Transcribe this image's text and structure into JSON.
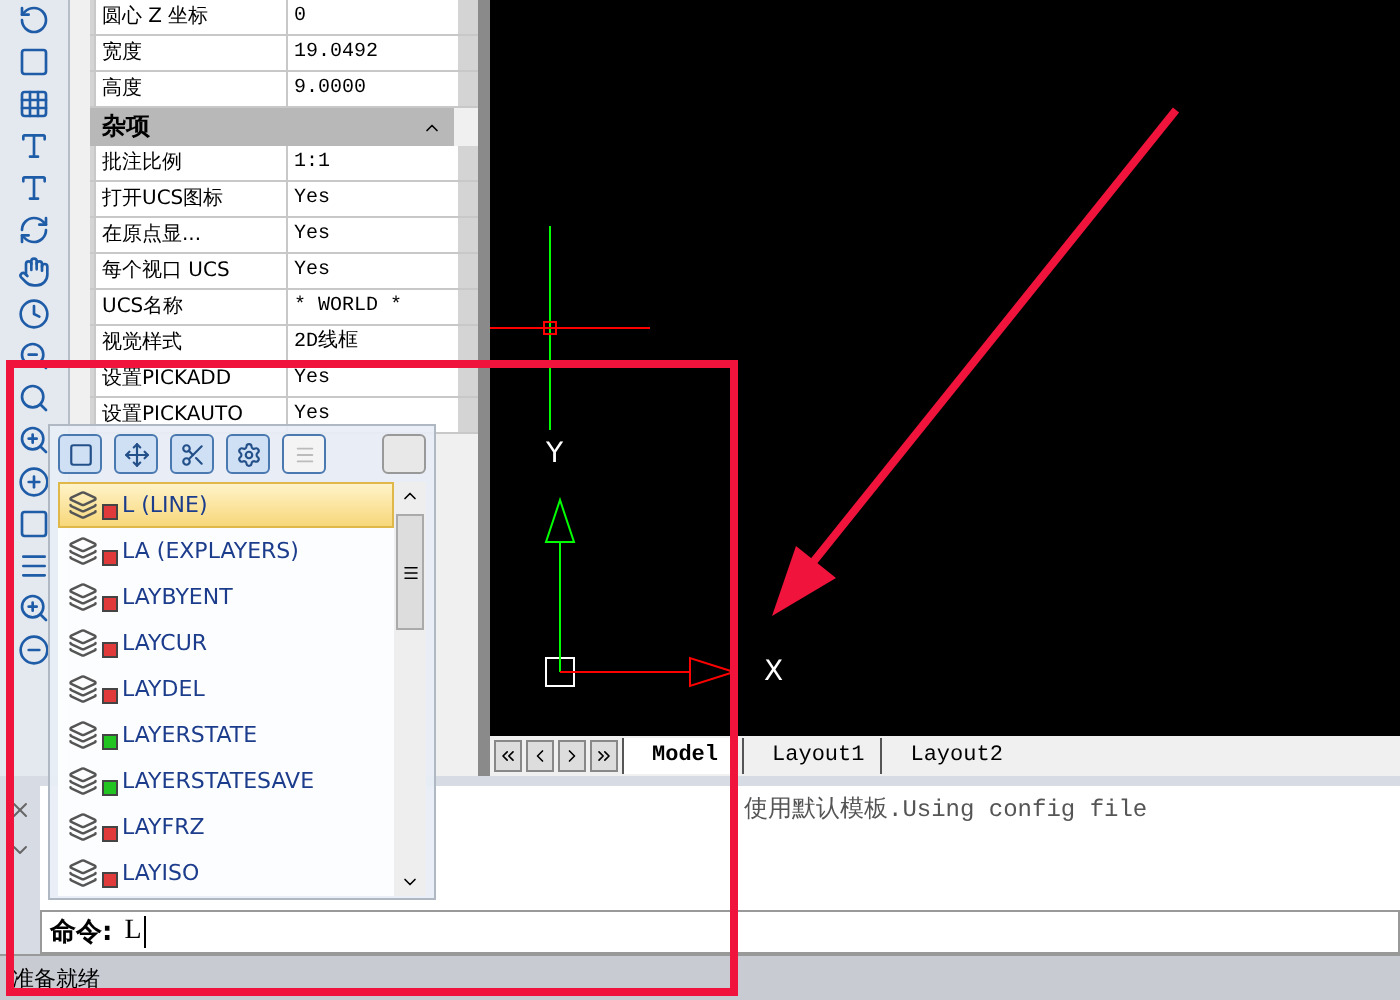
{
  "properties": [
    {
      "kind": "row",
      "name": "圆心 Z 坐标",
      "value": "0"
    },
    {
      "kind": "row",
      "name": "宽度",
      "value": "19.0492"
    },
    {
      "kind": "row",
      "name": "高度",
      "value": "9.0000"
    },
    {
      "kind": "section",
      "title": "杂项",
      "expanded": true
    },
    {
      "kind": "row",
      "name": "批注比例",
      "value": "1:1"
    },
    {
      "kind": "row",
      "name": "打开UCS图标",
      "value": "Yes"
    },
    {
      "kind": "row",
      "name": "在原点显...",
      "value": "Yes"
    },
    {
      "kind": "row",
      "name": "每个视口 UCS",
      "value": "Yes"
    },
    {
      "kind": "row",
      "name": "UCS名称",
      "value": "* WORLD *"
    },
    {
      "kind": "row",
      "name": "视觉样式",
      "value": "2D线框"
    },
    {
      "kind": "row",
      "name": "设置PICKADD",
      "value": "Yes"
    },
    {
      "kind": "row",
      "name": "设置PICKAUTO",
      "value": "Yes"
    }
  ],
  "autocomplete": {
    "items": [
      {
        "label": "L (LINE)",
        "selected": true,
        "color": "#e03a3a"
      },
      {
        "label": "LA (EXPLAYERS)",
        "selected": false,
        "color": "#e03a3a"
      },
      {
        "label": "LAYBYENT",
        "selected": false,
        "color": "#e03a3a"
      },
      {
        "label": "LAYCUR",
        "selected": false,
        "color": "#e03a3a"
      },
      {
        "label": "LAYDEL",
        "selected": false,
        "color": "#e03a3a"
      },
      {
        "label": "LAYERSTATE",
        "selected": false,
        "color": "#22c422"
      },
      {
        "label": "LAYERSTATESAVE",
        "selected": false,
        "color": "#22c422"
      },
      {
        "label": "LAYFRZ",
        "selected": false,
        "color": "#e03a3a"
      },
      {
        "label": "LAYISO",
        "selected": false,
        "color": "#e03a3a"
      }
    ]
  },
  "canvas": {
    "x_label": "X",
    "y_label": "Y"
  },
  "layout_tabs": [
    {
      "label": "Model",
      "selected": true
    },
    {
      "label": "Layout1",
      "selected": false
    },
    {
      "label": "Layout2",
      "selected": false
    }
  ],
  "command": {
    "history": [
      "使用默认模板.Using config file"
    ],
    "prompt": "命令:",
    "value": "L"
  },
  "status_bar": "准备就绪"
}
